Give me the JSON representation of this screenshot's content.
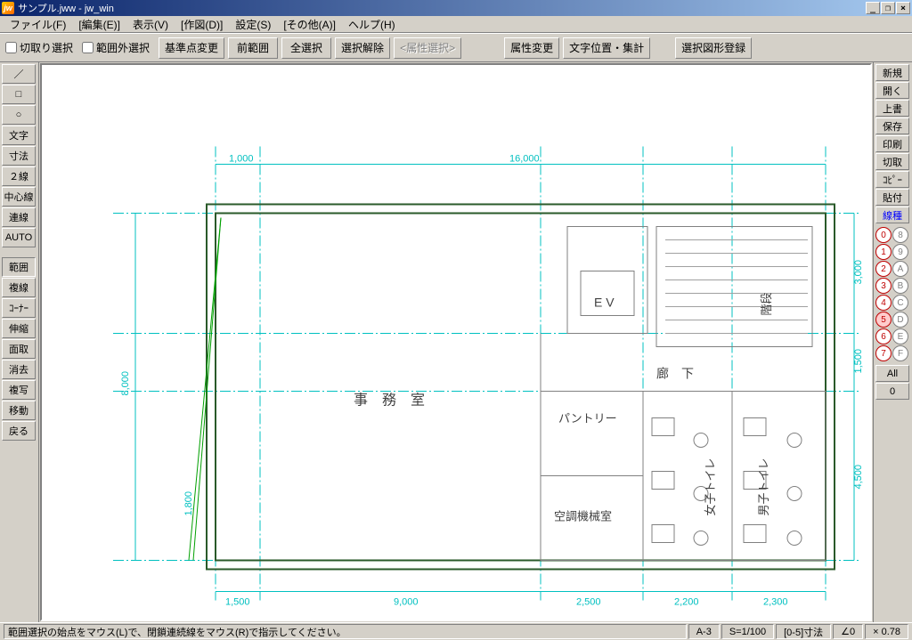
{
  "title": "サンプル.jww - jw_win",
  "menubar": [
    "ファイル(F)",
    "[編集(E)]",
    "表示(V)",
    "[作図(D)]",
    "設定(S)",
    "[その他(A)]",
    "ヘルプ(H)"
  ],
  "toolbar1": {
    "chk1": "切取り選択",
    "chk2": "範囲外選択",
    "btns": [
      "基準点変更",
      "前範囲",
      "全選択",
      "選択解除",
      "<属性選択>"
    ],
    "btns2": [
      "属性変更",
      "文字位置・集計"
    ],
    "btns3": [
      "選択図形登録"
    ]
  },
  "leftToolbar": {
    "group1": [
      "／",
      "□",
      "○",
      "文字",
      "寸法",
      "２線",
      "中心線",
      "連線",
      "AUTO"
    ],
    "group2": [
      "範囲",
      "複線",
      "ｺｰﾅｰ",
      "伸縮",
      "面取",
      "消去",
      "複写",
      "移動",
      "戻る"
    ]
  },
  "rightToolbar": {
    "top": [
      "新規",
      "開く",
      "上書",
      "保存",
      "印刷",
      "切取",
      "ｺﾋﾟｰ",
      "貼付",
      "線種"
    ],
    "circlesL": [
      "0",
      "1",
      "2",
      "3",
      "4",
      "5",
      "6",
      "7"
    ],
    "circlesR": [
      "8",
      "9",
      "A",
      "B",
      "C",
      "D",
      "E",
      "F"
    ],
    "bottom": [
      "All",
      "0"
    ]
  },
  "canvas": {
    "dims": {
      "w1": "1,000",
      "w_top": "16,000",
      "h_left": "8,000",
      "h_left2": "1,800",
      "w_b1": "1,500",
      "w_b2": "9,000",
      "w_b3": "2,500",
      "w_b4": "2,200",
      "w_b5": "2,300",
      "h_r1": "3,000",
      "h_r2": "1,500",
      "h_r3": "4,500"
    },
    "labels": {
      "office": "事　務　室",
      "ev": "E V",
      "stairs": "階段",
      "corridor": "廊　下",
      "pantry": "パントリー",
      "hvac": "空調機械室",
      "wct": "女子トイレ",
      "mct": "男子トイレ"
    }
  },
  "statusbar": {
    "msg": "範囲選択の始点をマウス(L)で、閉鎖連続線をマウス(R)で指示してください。",
    "cells": [
      "A-3",
      "S=1/100",
      "[0-5]寸法",
      "∠0",
      "× 0.78"
    ]
  }
}
